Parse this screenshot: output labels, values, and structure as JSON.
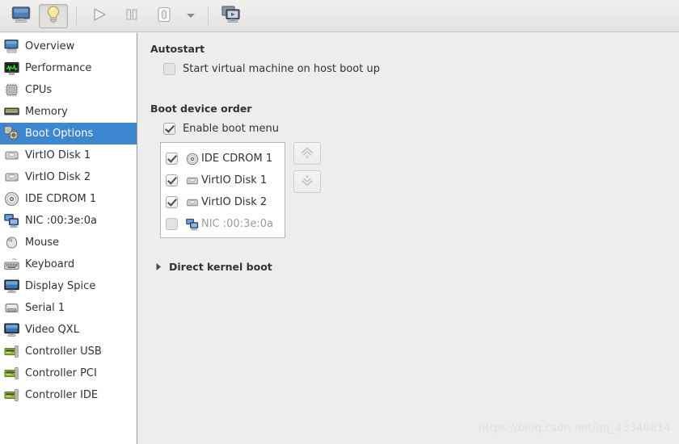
{
  "toolbar": {
    "buttons": [
      {
        "name": "show-console-button",
        "icon": "monitor-icon",
        "pressed": false,
        "label": "Console"
      },
      {
        "name": "show-details-button",
        "icon": "lightbulb-icon",
        "pressed": true,
        "label": "Details"
      },
      {
        "name": "run-button",
        "icon": "play-icon",
        "pressed": false,
        "label": "Run"
      },
      {
        "name": "pause-button",
        "icon": "pause-icon",
        "pressed": false,
        "label": "Pause"
      },
      {
        "name": "shutdown-button",
        "icon": "shutdown-icon",
        "pressed": false,
        "label": "Shut Down"
      },
      {
        "name": "shutdown-menu-button",
        "icon": "chevron-down-icon",
        "pressed": false,
        "label": ""
      },
      {
        "name": "snapshots-button",
        "icon": "screens-icon",
        "pressed": false,
        "label": "Snapshots"
      }
    ]
  },
  "sidebar": {
    "items": [
      {
        "label": "Overview",
        "icon": "computer-icon",
        "selected": false
      },
      {
        "label": "Performance",
        "icon": "graph-icon",
        "selected": false
      },
      {
        "label": "CPUs",
        "icon": "cpu-icon",
        "selected": false
      },
      {
        "label": "Memory",
        "icon": "memory-icon",
        "selected": false
      },
      {
        "label": "Boot Options",
        "icon": "boot-gear-icon",
        "selected": true
      },
      {
        "label": "VirtIO Disk 1",
        "icon": "harddisk-icon",
        "selected": false
      },
      {
        "label": "VirtIO Disk 2",
        "icon": "harddisk-icon",
        "selected": false
      },
      {
        "label": "IDE CDROM 1",
        "icon": "cdrom-icon",
        "selected": false
      },
      {
        "label": "NIC :00:3e:0a",
        "icon": "network-icon",
        "selected": false
      },
      {
        "label": "Mouse",
        "icon": "mouse-icon",
        "selected": false
      },
      {
        "label": "Keyboard",
        "icon": "keyboard-icon",
        "selected": false
      },
      {
        "label": "Display Spice",
        "icon": "display-icon",
        "selected": false
      },
      {
        "label": "Serial 1",
        "icon": "serial-icon",
        "selected": false
      },
      {
        "label": "Video QXL",
        "icon": "display-icon",
        "selected": false
      },
      {
        "label": "Controller USB",
        "icon": "controller-icon",
        "selected": false
      },
      {
        "label": "Controller PCI",
        "icon": "controller-icon",
        "selected": false
      },
      {
        "label": "Controller IDE",
        "icon": "controller-icon",
        "selected": false
      }
    ]
  },
  "main": {
    "autostart": {
      "title": "Autostart",
      "checkbox_label": "Start virtual machine on host boot up",
      "checked": false,
      "enabled": true
    },
    "boot_order": {
      "title": "Boot device order",
      "enable_menu_label": "Enable boot menu",
      "enable_menu_checked": true,
      "devices": [
        {
          "label": "IDE CDROM 1",
          "icon": "cdrom-icon",
          "checked": true,
          "enabled": true
        },
        {
          "label": "VirtIO Disk 1",
          "icon": "harddisk-icon",
          "checked": true,
          "enabled": true
        },
        {
          "label": "VirtIO Disk 2",
          "icon": "harddisk-icon",
          "checked": true,
          "enabled": true
        },
        {
          "label": "NIC :00:3e:0a",
          "icon": "network-icon",
          "checked": false,
          "enabled": false
        }
      ],
      "move_up_label": "Move device up",
      "move_down_label": "Move device down",
      "move_buttons_enabled": false
    },
    "direct_kernel_boot": {
      "label": "Direct kernel boot",
      "expanded": false
    }
  },
  "watermark": {
    "text": "https://blog.csdn.net/qq_43340814"
  },
  "colors": {
    "selection_blue": "#3c87d0",
    "panel_bg": "#ededed",
    "sidebar_bg": "#ffffff",
    "text": "#2e3436",
    "disabled_text": "#9d9c9a"
  }
}
